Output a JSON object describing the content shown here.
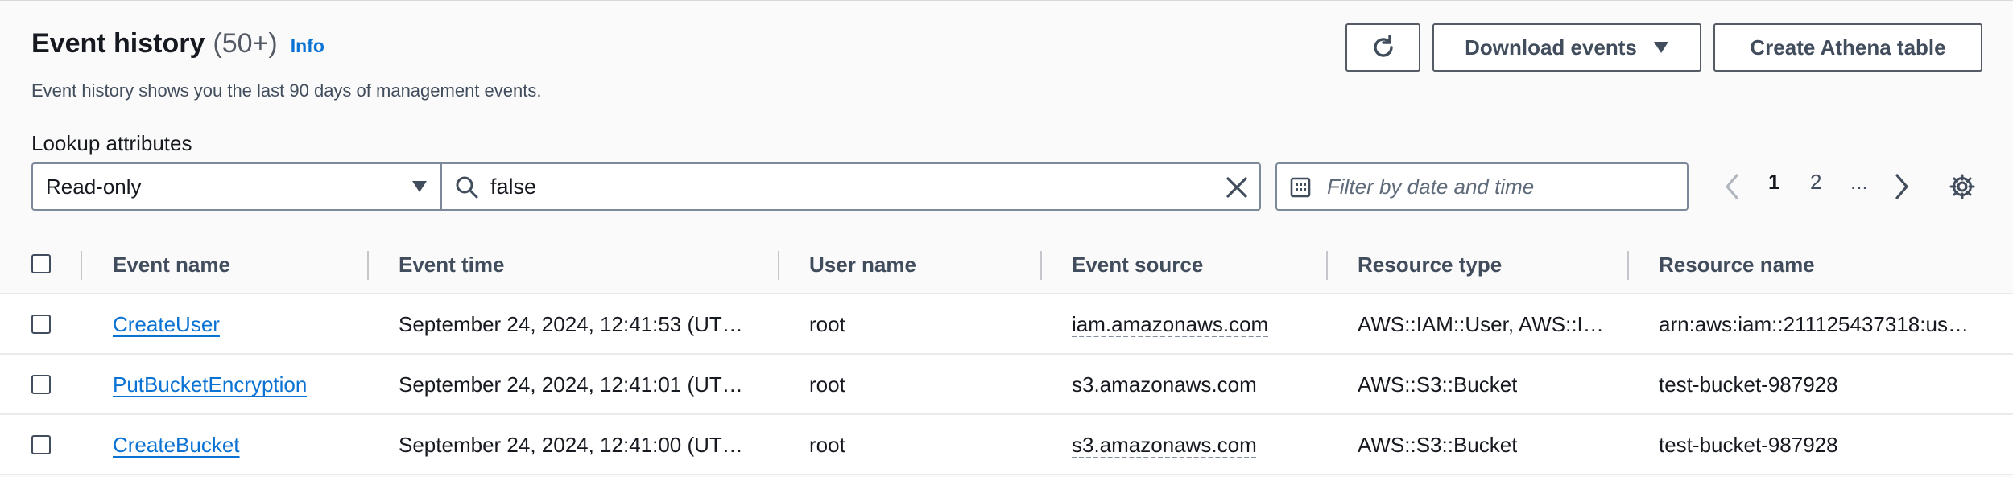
{
  "header": {
    "title": "Event history",
    "count": "(50+)",
    "info_label": "Info",
    "description": "Event history shows you the last 90 days of management events."
  },
  "actions": {
    "refresh_icon": "refresh-icon",
    "download_label": "Download events",
    "athena_label": "Create Athena table"
  },
  "lookup": {
    "label": "Lookup attributes",
    "selected_attribute": "Read-only",
    "search_value": "false",
    "date_placeholder": "Filter by date and time"
  },
  "pagination": {
    "pages": [
      "1",
      "2",
      "..."
    ],
    "current": "1"
  },
  "table": {
    "columns": [
      "Event name",
      "Event time",
      "User name",
      "Event source",
      "Resource type",
      "Resource name"
    ],
    "rows": [
      {
        "event_name": "CreateUser",
        "event_time": "September 24, 2024, 12:41:53 (UT…",
        "user_name": "root",
        "event_source": "iam.amazonaws.com",
        "resource_type": "AWS::IAM::User, AWS::I…",
        "resource_name": "arn:aws:iam::211125437318:us…"
      },
      {
        "event_name": "PutBucketEncryption",
        "event_time": "September 24, 2024, 12:41:01 (UT…",
        "user_name": "root",
        "event_source": "s3.amazonaws.com",
        "resource_type": "AWS::S3::Bucket",
        "resource_name": "test-bucket-987928"
      },
      {
        "event_name": "CreateBucket",
        "event_time": "September 24, 2024, 12:41:00 (UT…",
        "user_name": "root",
        "event_source": "s3.amazonaws.com",
        "resource_type": "AWS::S3::Bucket",
        "resource_name": "test-bucket-987928"
      }
    ]
  },
  "colors": {
    "link": "#0972d3",
    "text": "#16191f",
    "border": "#7d8998",
    "background": "#fafafa"
  }
}
